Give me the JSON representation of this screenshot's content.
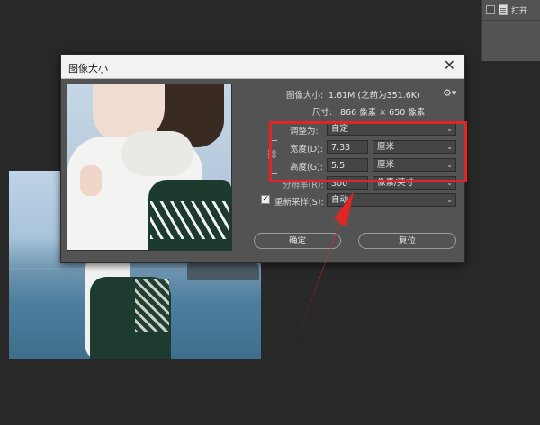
{
  "panel": {
    "label": "打开"
  },
  "dialog": {
    "title": "图像大小",
    "close": "✕",
    "image_size_label": "图像大小:",
    "image_size_value": "1.61M (之前为351.6K)",
    "dimensions_label": "尺寸:",
    "dimensions_value": "866 像素  ×  650 像素",
    "fit_label": "调整为:",
    "fit_value": "自定",
    "width_label": "宽度(D):",
    "width_value": "7.33",
    "width_unit": "厘米",
    "height_label": "高度(G):",
    "height_value": "5.5",
    "height_unit": "厘米",
    "resolution_label": "分辨率(R):",
    "resolution_value": "300",
    "resolution_unit": "像素/英寸",
    "resample_label": "重新采样(S):",
    "resample_value": "自动",
    "ok": "确定",
    "reset": "复位"
  },
  "colors": {
    "annotation": "#e02525",
    "dialog_bg": "#535353",
    "canvas_bg": "#282828"
  },
  "icons": [
    "gear-icon",
    "link-icon",
    "close-icon",
    "document-icon",
    "dropdown-arrow-icon"
  ]
}
